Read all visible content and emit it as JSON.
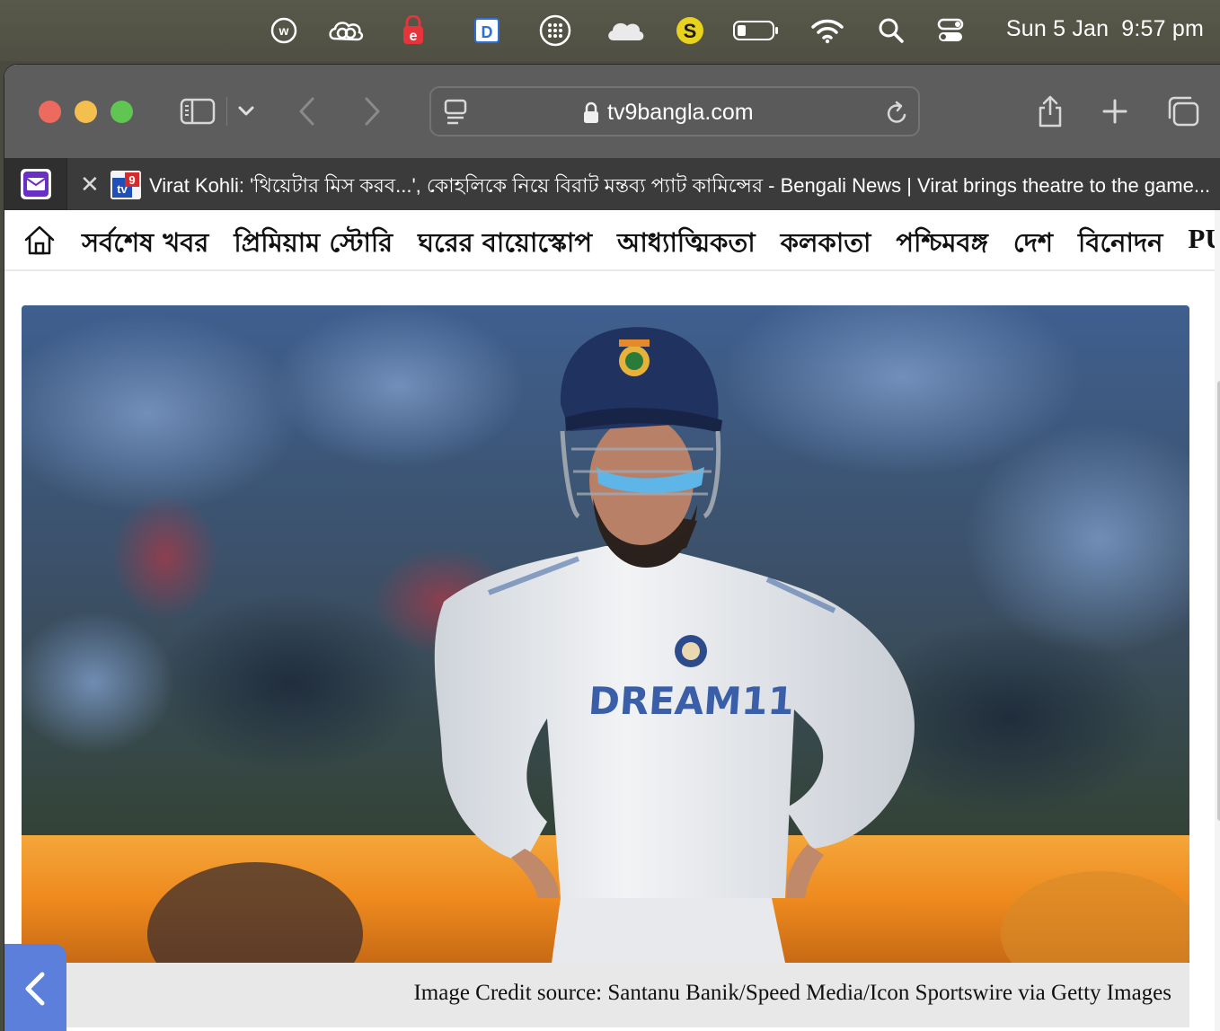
{
  "menubar": {
    "icons": [
      "w-circle-icon",
      "creative-cloud-icon",
      "e-lock-icon",
      "d-app-icon",
      "launchpad-grid-icon",
      "cloud-icon",
      "s-app-icon",
      "battery-icon",
      "wifi-icon",
      "spotlight-search-icon",
      "control-center-icon"
    ],
    "date": "Sun 5 Jan",
    "time": "9:57 pm"
  },
  "toolbar": {
    "url": "tv9bangla.com"
  },
  "tabs": {
    "active_title": "Virat Kohli: 'থিয়েটার মিস করব...', কোহলিকে নিয়ে বিরাট মন্তব্য প্যাট কামিন্সের - Bengali News | Virat brings theatre to the game..."
  },
  "nav": {
    "items": [
      "সর্বশেষ খবর",
      "প্রিমিয়াম স্টোরি",
      "ঘরের বায়োস্কোপ",
      "আধ্যাত্মিকতা",
      "কলকাতা",
      "পশ্চিমবঙ্গ",
      "দেশ",
      "বিনোদন",
      "PUJO"
    ]
  },
  "hero": {
    "jersey_sponsor": "DREAM11",
    "caption": "Image Credit source: Santanu Banik/Speed Media/Icon Sportswire via Getty Images"
  },
  "colors": {
    "accent": "#5b7fdb",
    "toolbar": "#5d5d5d"
  }
}
